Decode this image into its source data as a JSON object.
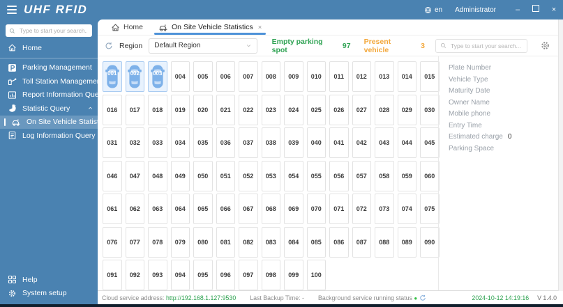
{
  "titlebar": {
    "brand": "UHF RFID",
    "lang": "en",
    "user": "Administrator",
    "minimize": "–",
    "close": "×"
  },
  "sidebar": {
    "search_placeholder": "Type to start your search...",
    "items": [
      {
        "label": "Home",
        "icon": "home-icon",
        "divider_after": true
      },
      {
        "label": "Parking Management",
        "icon": "parking-icon",
        "chevron": "down"
      },
      {
        "label": "Toll Station Management",
        "icon": "toll-station-icon"
      },
      {
        "label": "Report Information Query",
        "icon": "report-icon",
        "chevron": "down"
      },
      {
        "label": "Statistic Query",
        "icon": "pie-icon",
        "chevron": "up"
      },
      {
        "label": "On Site Vehicle Statistics",
        "icon": "car-icon",
        "selected": true,
        "sub": true
      },
      {
        "label": "Log Information Query",
        "icon": "log-icon"
      }
    ],
    "footer": [
      {
        "label": "Help",
        "icon": "help-icon"
      },
      {
        "label": "System setup",
        "icon": "gear-icon"
      }
    ]
  },
  "tabs": [
    {
      "label": "Home",
      "icon": "home-icon"
    },
    {
      "label": "On Site Vehicle Statistics",
      "icon": "car-icon",
      "active": true,
      "close": "×"
    }
  ],
  "toolbar": {
    "region_label": "Region",
    "region_value": "Default Region",
    "empty_label": "Empty parking spot",
    "empty_value": "97",
    "present_label": "Present vehicle",
    "present_value": "3",
    "search_placeholder": "Type to start your search..."
  },
  "parking": {
    "occupied": [
      "001",
      "002",
      "003"
    ],
    "spots": [
      "001",
      "002",
      "003",
      "004",
      "005",
      "006",
      "007",
      "008",
      "009",
      "010",
      "011",
      "012",
      "013",
      "014",
      "015",
      "016",
      "017",
      "018",
      "019",
      "020",
      "021",
      "022",
      "023",
      "024",
      "025",
      "026",
      "027",
      "028",
      "029",
      "030",
      "031",
      "032",
      "033",
      "034",
      "035",
      "036",
      "037",
      "038",
      "039",
      "040",
      "041",
      "042",
      "043",
      "044",
      "045",
      "046",
      "047",
      "048",
      "049",
      "050",
      "051",
      "052",
      "053",
      "054",
      "055",
      "056",
      "057",
      "058",
      "059",
      "060",
      "061",
      "062",
      "063",
      "064",
      "065",
      "066",
      "067",
      "068",
      "069",
      "070",
      "071",
      "072",
      "073",
      "074",
      "075",
      "076",
      "077",
      "078",
      "079",
      "080",
      "081",
      "082",
      "083",
      "084",
      "085",
      "086",
      "087",
      "088",
      "089",
      "090",
      "091",
      "092",
      "093",
      "094",
      "095",
      "096",
      "097",
      "098",
      "099",
      "100"
    ]
  },
  "detail_panel": {
    "fields": [
      {
        "label": "Plate Number",
        "value": ""
      },
      {
        "label": "Vehicle Type",
        "value": ""
      },
      {
        "label": "Maturity Date",
        "value": ""
      },
      {
        "label": "Owner Name",
        "value": ""
      },
      {
        "label": "Mobile phone",
        "value": ""
      },
      {
        "label": "Entry Time",
        "value": ""
      },
      {
        "label": "Estimated charge",
        "value": "0"
      },
      {
        "label": "Parking Space",
        "value": ""
      }
    ]
  },
  "statusbar": {
    "cloud_label": "Cloud service address:",
    "cloud_url": "http://192.168.1.127:9530",
    "backup_label": "Last Backup Time: -",
    "bg_status_label": "Background service running status",
    "datetime": "2024-10-12 14:19:16",
    "version": "V 1.4.0"
  },
  "colors": {
    "accent_blue": "#4a82b1",
    "tab_underline": "#4e92d8",
    "green": "#30a354",
    "orange": "#f3a73a",
    "occupied_car": "#7db1e9",
    "dark_strip": "#101f2d"
  }
}
